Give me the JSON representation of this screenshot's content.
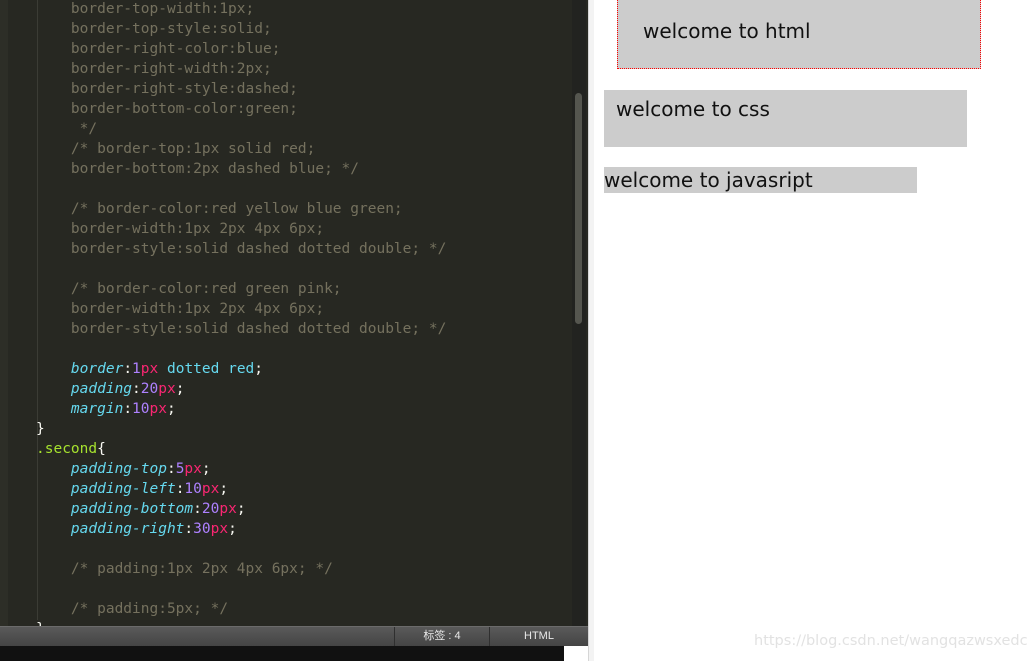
{
  "editor": {
    "lines": [
      [
        [
          "    border-top-width:1px;",
          "cm"
        ]
      ],
      [
        [
          "    border-top-style:solid;",
          "cm"
        ]
      ],
      [
        [
          "    border-right-color:blue;",
          "cm"
        ]
      ],
      [
        [
          "    border-right-width:2px;",
          "cm"
        ]
      ],
      [
        [
          "    border-right-style:dashed;",
          "cm"
        ]
      ],
      [
        [
          "    border-bottom-color:green;",
          "cm"
        ]
      ],
      [
        [
          "     */",
          "cm"
        ]
      ],
      [
        [
          "    /* border-top:1px solid red;",
          "cm"
        ]
      ],
      [
        [
          "    border-bottom:2px dashed blue; */",
          "cm"
        ]
      ],
      [],
      [
        [
          "    /* border-color:red yellow blue green;",
          "cm"
        ]
      ],
      [
        [
          "    border-width:1px 2px 4px 6px;",
          "cm"
        ]
      ],
      [
        [
          "    border-style:solid dashed dotted double; */",
          "cm"
        ]
      ],
      [],
      [
        [
          "    /* border-color:red green pink;",
          "cm"
        ]
      ],
      [
        [
          "    border-width:1px 2px 4px 6px;",
          "cm"
        ]
      ],
      [
        [
          "    border-style:solid dashed dotted double; */",
          "cm"
        ]
      ],
      [],
      [
        [
          "    ",
          "punct"
        ],
        [
          "border",
          "prop"
        ],
        [
          ":",
          "punct"
        ],
        [
          "1",
          "num"
        ],
        [
          "px",
          "unit"
        ],
        [
          " dotted red",
          "val"
        ],
        [
          ";",
          "punct"
        ]
      ],
      [
        [
          "    ",
          "punct"
        ],
        [
          "padding",
          "prop"
        ],
        [
          ":",
          "punct"
        ],
        [
          "20",
          "num"
        ],
        [
          "px",
          "unit"
        ],
        [
          ";",
          "punct"
        ]
      ],
      [
        [
          "    ",
          "punct"
        ],
        [
          "margin",
          "prop"
        ],
        [
          ":",
          "punct"
        ],
        [
          "10",
          "num"
        ],
        [
          "px",
          "unit"
        ],
        [
          ";",
          "punct"
        ]
      ],
      [
        [
          "}",
          "punct"
        ]
      ],
      [
        [
          ".second",
          "sel"
        ],
        [
          "{",
          "punct"
        ]
      ],
      [
        [
          "    ",
          "punct"
        ],
        [
          "padding-top",
          "prop"
        ],
        [
          ":",
          "punct"
        ],
        [
          "5",
          "num"
        ],
        [
          "px",
          "unit"
        ],
        [
          ";",
          "punct"
        ]
      ],
      [
        [
          "    ",
          "punct"
        ],
        [
          "padding-left",
          "prop"
        ],
        [
          ":",
          "punct"
        ],
        [
          "10",
          "num"
        ],
        [
          "px",
          "unit"
        ],
        [
          ";",
          "punct"
        ]
      ],
      [
        [
          "    ",
          "punct"
        ],
        [
          "padding-bottom",
          "prop"
        ],
        [
          ":",
          "punct"
        ],
        [
          "20",
          "num"
        ],
        [
          "px",
          "unit"
        ],
        [
          ";",
          "punct"
        ]
      ],
      [
        [
          "    ",
          "punct"
        ],
        [
          "padding-right",
          "prop"
        ],
        [
          ":",
          "punct"
        ],
        [
          "30",
          "num"
        ],
        [
          "px",
          "unit"
        ],
        [
          ";",
          "punct"
        ]
      ],
      [],
      [
        [
          "    /* padding:1px 2px 4px 6px; */",
          "cm"
        ]
      ],
      [],
      [
        [
          "    /* padding:5px; */",
          "cm"
        ]
      ],
      [
        [
          "}",
          "punct"
        ]
      ]
    ],
    "colors": {
      "background": "#272822",
      "comment": "#75715e",
      "property": "#66d9ef",
      "number": "#ae81ff",
      "unit": "#f92672",
      "selector": "#a6e22e"
    }
  },
  "statusbar": {
    "tab_info": "标签 : 4",
    "syntax": "HTML"
  },
  "preview": {
    "first_text": "welcome to html",
    "second_text": "welcome to css",
    "third_text": "welcome to javasript",
    "box_background": "#cccccc",
    "first_border_color": "#ff0000"
  },
  "watermark": "https://blog.csdn.net/wangqazwsxedc"
}
